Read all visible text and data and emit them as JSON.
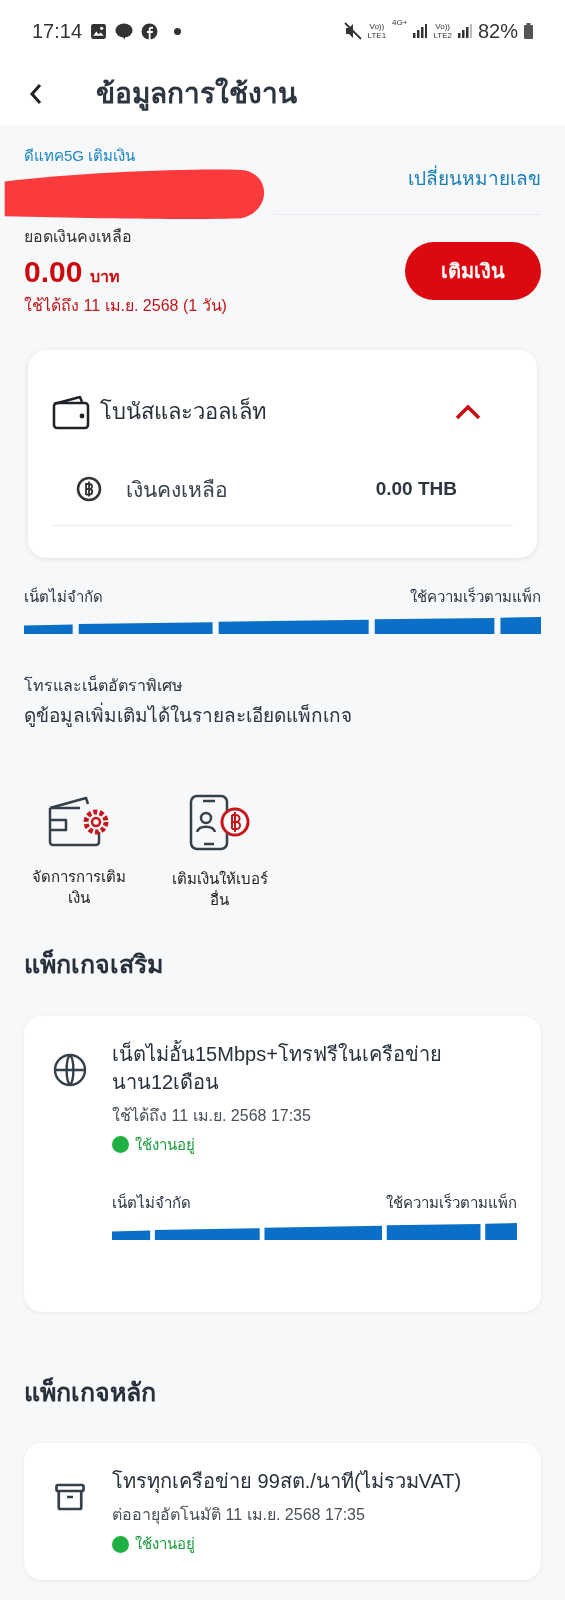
{
  "status_bar": {
    "time": "17:14",
    "sim1": {
      "voice": "Vo))",
      "network": "LTE1"
    },
    "data": "4G+",
    "sim2": {
      "voice": "Vo))",
      "network": "LTE2"
    },
    "battery": "82%"
  },
  "header": {
    "title": "ข้อมูลการใช้งาน"
  },
  "account": {
    "plan": "ดีแทค5G เติมเงิน",
    "change_number": "เปลี่ยนหมายเลข",
    "balance_label": "ยอดเงินคงเหลือ",
    "balance": "0.00",
    "currency": "บาท",
    "valid_until": "ใช้ได้ถึง 11 เม.ย. 2568 (1 วัน)",
    "top_up": "เติมเงิน"
  },
  "wallet_card": {
    "title": "โบนัสและวอลเล็ท",
    "expanded": true,
    "rows": [
      {
        "label": "เงินคงเหลือ",
        "value": "0.00 THB"
      }
    ]
  },
  "speed": {
    "left": "เน็ตไม่จำกัด",
    "right": "ใช้ความเร็วตามแพ็ก"
  },
  "special_rates": {
    "title": "โทรและเน็ตอัตราพิเศษ",
    "detail": "ดูข้อมูลเพิ่มเติมได้ในรายละเอียดแพ็กเกจ"
  },
  "shortcuts": [
    {
      "kind": "wallet",
      "label": "จัดการการเติมเงิน"
    },
    {
      "kind": "phone",
      "label": "เติมเงินให้เบอร์อื่น"
    }
  ],
  "addon_packages": {
    "heading": "แพ็กเกจเสริม",
    "items": [
      {
        "kind": "internet",
        "name": "เน็ตไม่อั้น15Mbps+โทรฟรีในเครือข่ายนาน12เดือน",
        "until": "ใช้ได้ถึง 11 เม.ย. 2568 17:35",
        "status": "ใช้งานอยู่",
        "color": "#1fb141",
        "speed": {
          "left": "เน็ตไม่จำกัด",
          "right": "ใช้ความเร็วตามแพ็ก"
        }
      }
    ]
  },
  "main_packages": {
    "heading": "แพ็กเกจหลัก",
    "items": [
      {
        "kind": "box",
        "name": "โทรทุกเครือข่าย 99สต./นาที(ไม่รวมVAT)",
        "until": "ต่ออายุอัตโนมัติ 11 เม.ย. 2568 17:35",
        "status": "ใช้งานอยู่",
        "color": "#1fb141"
      }
    ]
  }
}
